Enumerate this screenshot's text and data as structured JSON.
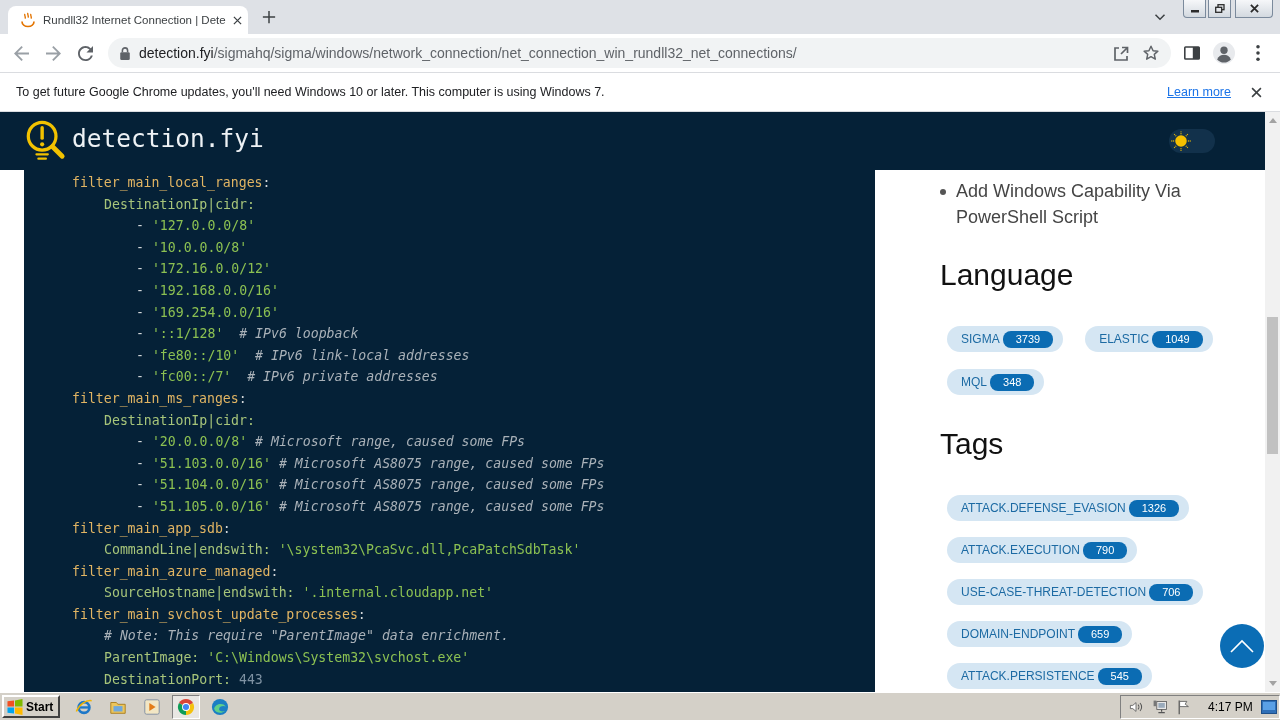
{
  "browser": {
    "tabs": [
      {
        "title": "Rundll32 Internet Connection | Dete",
        "selected": true
      }
    ],
    "address": {
      "domain": "detection.fyi",
      "path": "/sigmahq/sigma/windows/network_connection/net_connection_win_rundll32_net_connections/"
    },
    "update_bar": {
      "message": "To get future Google Chrome updates, you'll need Windows 10 or later. This computer is using Windows 7.",
      "link": "Learn more"
    }
  },
  "site_header": {
    "logo": "detection.fyi",
    "theme_toggle": {
      "on": false
    }
  },
  "rule_yaml": [
    {
      "tokens": [
        {
          "kind": "key",
          "text": "filter_main_local_ranges"
        },
        {
          "kind": "punct",
          "text": ":"
        }
      ],
      "children": [
        {
          "tokens": [
            {
              "kind": "field",
              "text": "DestinationIp|cidr:"
            }
          ],
          "children": [
            {
              "tokens": [
                {
                  "kind": "punct",
                  "text": "-"
                },
                {
                  "kind": "string",
                  "text": " '127.0.0.0/8'"
                }
              ]
            },
            {
              "tokens": [
                {
                  "kind": "punct",
                  "text": "-"
                },
                {
                  "kind": "string",
                  "text": " '10.0.0.0/8'"
                }
              ]
            },
            {
              "tokens": [
                {
                  "kind": "punct",
                  "text": "-"
                },
                {
                  "kind": "string",
                  "text": " '172.16.0.0/12'"
                }
              ]
            },
            {
              "tokens": [
                {
                  "kind": "punct",
                  "text": "-"
                },
                {
                  "kind": "string",
                  "text": " '192.168.0.0/16'"
                }
              ]
            },
            {
              "tokens": [
                {
                  "kind": "punct",
                  "text": "-"
                },
                {
                  "kind": "string",
                  "text": " '169.254.0.0/16'"
                }
              ]
            },
            {
              "tokens": [
                {
                  "kind": "punct",
                  "text": "-"
                },
                {
                  "kind": "string",
                  "text": " '::1/128'"
                },
                {
                  "kind": "comment",
                  "text": "  # IPv6 loopback"
                }
              ]
            },
            {
              "tokens": [
                {
                  "kind": "punct",
                  "text": "-"
                },
                {
                  "kind": "string",
                  "text": " 'fe80::/10'"
                },
                {
                  "kind": "comment",
                  "text": "  # IPv6 link-local addresses"
                }
              ]
            },
            {
              "tokens": [
                {
                  "kind": "punct",
                  "text": "-"
                },
                {
                  "kind": "string",
                  "text": " 'fc00::/7'"
                },
                {
                  "kind": "comment",
                  "text": "  # IPv6 private addresses"
                }
              ]
            }
          ]
        }
      ]
    },
    {
      "tokens": [
        {
          "kind": "key",
          "text": "filter_main_ms_ranges"
        },
        {
          "kind": "punct",
          "text": ":"
        }
      ],
      "children": [
        {
          "tokens": [
            {
              "kind": "field",
              "text": "DestinationIp|cidr:"
            }
          ],
          "children": [
            {
              "tokens": [
                {
                  "kind": "punct",
                  "text": "-"
                },
                {
                  "kind": "string",
                  "text": " '20.0.0.0/8'"
                },
                {
                  "kind": "comment",
                  "text": " # Microsoft range, caused some FPs"
                }
              ]
            },
            {
              "tokens": [
                {
                  "kind": "punct",
                  "text": "-"
                },
                {
                  "kind": "string",
                  "text": " '51.103.0.0/16'"
                },
                {
                  "kind": "comment",
                  "text": " # Microsoft AS8075 range, caused some FPs"
                }
              ]
            },
            {
              "tokens": [
                {
                  "kind": "punct",
                  "text": "-"
                },
                {
                  "kind": "string",
                  "text": " '51.104.0.0/16'"
                },
                {
                  "kind": "comment",
                  "text": " # Microsoft AS8075 range, caused some FPs"
                }
              ]
            },
            {
              "tokens": [
                {
                  "kind": "punct",
                  "text": "-"
                },
                {
                  "kind": "string",
                  "text": " '51.105.0.0/16'"
                },
                {
                  "kind": "comment",
                  "text": " # Microsoft AS8075 range, caused some FPs"
                }
              ]
            }
          ]
        }
      ]
    },
    {
      "tokens": [
        {
          "kind": "key",
          "text": "filter_main_app_sdb"
        },
        {
          "kind": "punct",
          "text": ":"
        }
      ],
      "children": [
        {
          "tokens": [
            {
              "kind": "field",
              "text": "CommandLine|endswith:"
            },
            {
              "kind": "string",
              "text": " '\\system32\\PcaSvc.dll,PcaPatchSdbTask'"
            }
          ]
        }
      ]
    },
    {
      "tokens": [
        {
          "kind": "key",
          "text": "filter_main_azure_managed"
        },
        {
          "kind": "punct",
          "text": ":"
        }
      ],
      "children": [
        {
          "tokens": [
            {
              "kind": "field",
              "text": "SourceHostname|endswith:"
            },
            {
              "kind": "string",
              "text": " '.internal.cloudapp.net'"
            }
          ]
        }
      ]
    },
    {
      "tokens": [
        {
          "kind": "key",
          "text": "filter_main_svchost_update_processes"
        },
        {
          "kind": "punct",
          "text": ":"
        }
      ],
      "children": [
        {
          "tokens": [
            {
              "kind": "comment",
              "text": "# Note: This require \"ParentImage\" data enrichment."
            }
          ]
        },
        {
          "tokens": [
            {
              "kind": "field",
              "text": "ParentImage:"
            },
            {
              "kind": "string",
              "text": " 'C:\\Windows\\System32\\svchost.exe'"
            }
          ]
        },
        {
          "tokens": [
            {
              "kind": "field",
              "text": "DestinationPort:"
            },
            {
              "kind": "number",
              "text": " 443"
            }
          ]
        }
      ]
    }
  ],
  "sidebar": {
    "related_rules": [
      "Add Windows Capability Via PowerShell Script"
    ],
    "sections": [
      {
        "title": "Language",
        "chips": [
          {
            "label": "SIGMA",
            "count": "3739"
          },
          {
            "label": "ELASTIC",
            "count": "1049"
          },
          {
            "label": "MQL",
            "count": "348"
          }
        ]
      },
      {
        "title": "Tags",
        "chips": [
          {
            "label": "ATTACK.DEFENSE_EVASION",
            "count": "1326"
          },
          {
            "label": "ATTACK.EXECUTION",
            "count": "790"
          },
          {
            "label": "USE-CASE-THREAT-DETECTION",
            "count": "706"
          },
          {
            "label": "DOMAIN-ENDPOINT",
            "count": "659"
          },
          {
            "label": "ATTACK.PERSISTENCE",
            "count": "545"
          }
        ]
      }
    ]
  },
  "taskbar": {
    "start": "Start",
    "apps": [
      {
        "kind": "globe",
        "active": false
      },
      {
        "kind": "folder",
        "active": false
      },
      {
        "kind": "player",
        "active": false
      },
      {
        "kind": "wheel",
        "active": true
      },
      {
        "kind": "wave",
        "active": false
      }
    ],
    "clock": "4:17 PM"
  }
}
